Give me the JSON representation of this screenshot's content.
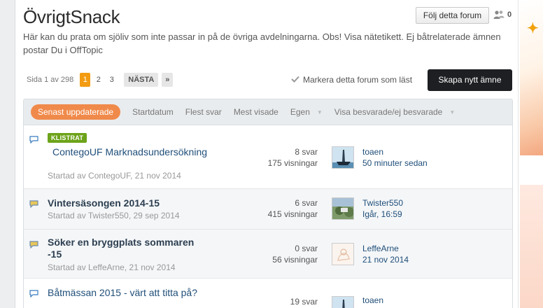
{
  "forum": {
    "title": "ÖvrigtSnack",
    "description": "Här kan du prata om sjöliv som inte passar in på de övriga avdelningarna. Obs! Visa nätetikett. Ej båtrelaterade ämnen postar Du i OffTopic",
    "follow_label": "Följ detta forum",
    "followers_count": "0"
  },
  "pager": {
    "page_label": "Sida 1 av 298",
    "pages": [
      "1",
      "2",
      "3"
    ],
    "next_label": "NÄSTA",
    "last_label": "»"
  },
  "actions": {
    "mark_read_label": "Markera detta forum som läst",
    "create_label": "Skapa nytt ämne"
  },
  "tabs": [
    {
      "label": "Senast uppdaterade"
    },
    {
      "label": "Startdatum"
    },
    {
      "label": "Flest svar"
    },
    {
      "label": "Mest visade"
    },
    {
      "label": "Egen"
    },
    {
      "label": "Visa besvarade/ej besvarade"
    }
  ],
  "topics": [
    {
      "sticky_label": "KLISTRAT",
      "title": "ContegoUF Marknadsundersökning",
      "started": "Startad av ContegoUF, 21 nov 2014",
      "replies": "8 svar",
      "views": "175 visningar",
      "last_user": "toaen",
      "last_time": "50 minuter sedan"
    },
    {
      "title": "Vintersäsongen 2014-15",
      "started": "Startad av Twister550, 29 sep 2014",
      "replies": "6 svar",
      "views": "415 visningar",
      "last_user": "Twister550",
      "last_time": "Igår, 16:59"
    },
    {
      "title": "Söker en bryggplats sommaren -15",
      "started": "Startad av LeffeArne, 21 nov 2014",
      "replies": "0 svar",
      "views": "56 visningar",
      "last_user": "LeffeArne",
      "last_time": "21 nov 2014"
    },
    {
      "title": "Båtmässan 2015 - värt att titta på?",
      "replies": "19 svar",
      "last_user": "toaen"
    }
  ],
  "colors": {
    "accent": "#f39c12",
    "tab_active": "#f08a4b",
    "create_button": "#1d1f22",
    "sticky": "#6da31a",
    "link": "#1f4e79"
  }
}
